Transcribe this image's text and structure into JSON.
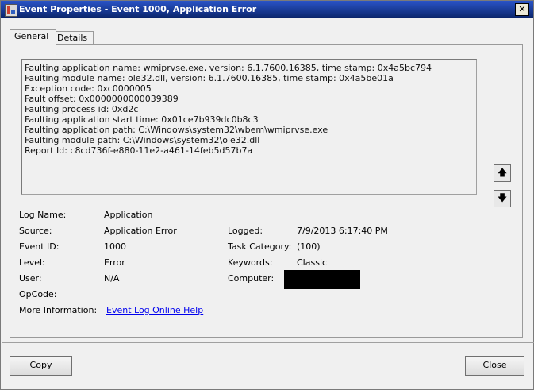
{
  "window": {
    "title": "Event Properties - Event 1000, Application Error",
    "close_label": "✕"
  },
  "tabs": [
    {
      "label": "General",
      "active": true
    },
    {
      "label": "Details",
      "active": false
    }
  ],
  "description": [
    "Faulting application name: wmiprvse.exe, version: 6.1.7600.16385, time stamp: 0x4a5bc794",
    "Faulting module name: ole32.dll, version: 6.1.7600.16385, time stamp: 0x4a5be01a",
    "Exception code: 0xc0000005",
    "Fault offset: 0x0000000000039389",
    "Faulting process id: 0xd2c",
    "Faulting application start time: 0x01ce7b939dc0b8c3",
    "Faulting application path: C:\\Windows\\system32\\wbem\\wmiprvse.exe",
    "Faulting module path: C:\\Windows\\system32\\ole32.dll",
    "Report Id: c8cd736f-e880-11e2-a461-14feb5d57b7a"
  ],
  "nav": {
    "up_icon": "arrow-up-icon",
    "down_icon": "arrow-down-icon",
    "up_glyph": "🡅",
    "down_glyph": "🡇"
  },
  "props": {
    "log_name": {
      "label": "Log Name:",
      "value": "Application"
    },
    "source": {
      "label": "Source:",
      "value": "Application Error"
    },
    "event_id": {
      "label": "Event ID:",
      "value": "1000"
    },
    "level": {
      "label": "Level:",
      "value": "Error"
    },
    "user": {
      "label": "User:",
      "value": "N/A"
    },
    "opcode": {
      "label": "OpCode:",
      "value": ""
    },
    "more_info": {
      "label": "More Information:",
      "link": "Event Log Online Help"
    },
    "logged": {
      "label": "Logged:",
      "value": "7/9/2013 6:17:40 PM"
    },
    "task_category": {
      "label": "Task Category:",
      "value": "(100)"
    },
    "keywords": {
      "label": "Keywords:",
      "value": "Classic"
    },
    "computer": {
      "label": "Computer:",
      "value": ""
    }
  },
  "buttons": {
    "copy": "Copy",
    "close": "Close"
  }
}
